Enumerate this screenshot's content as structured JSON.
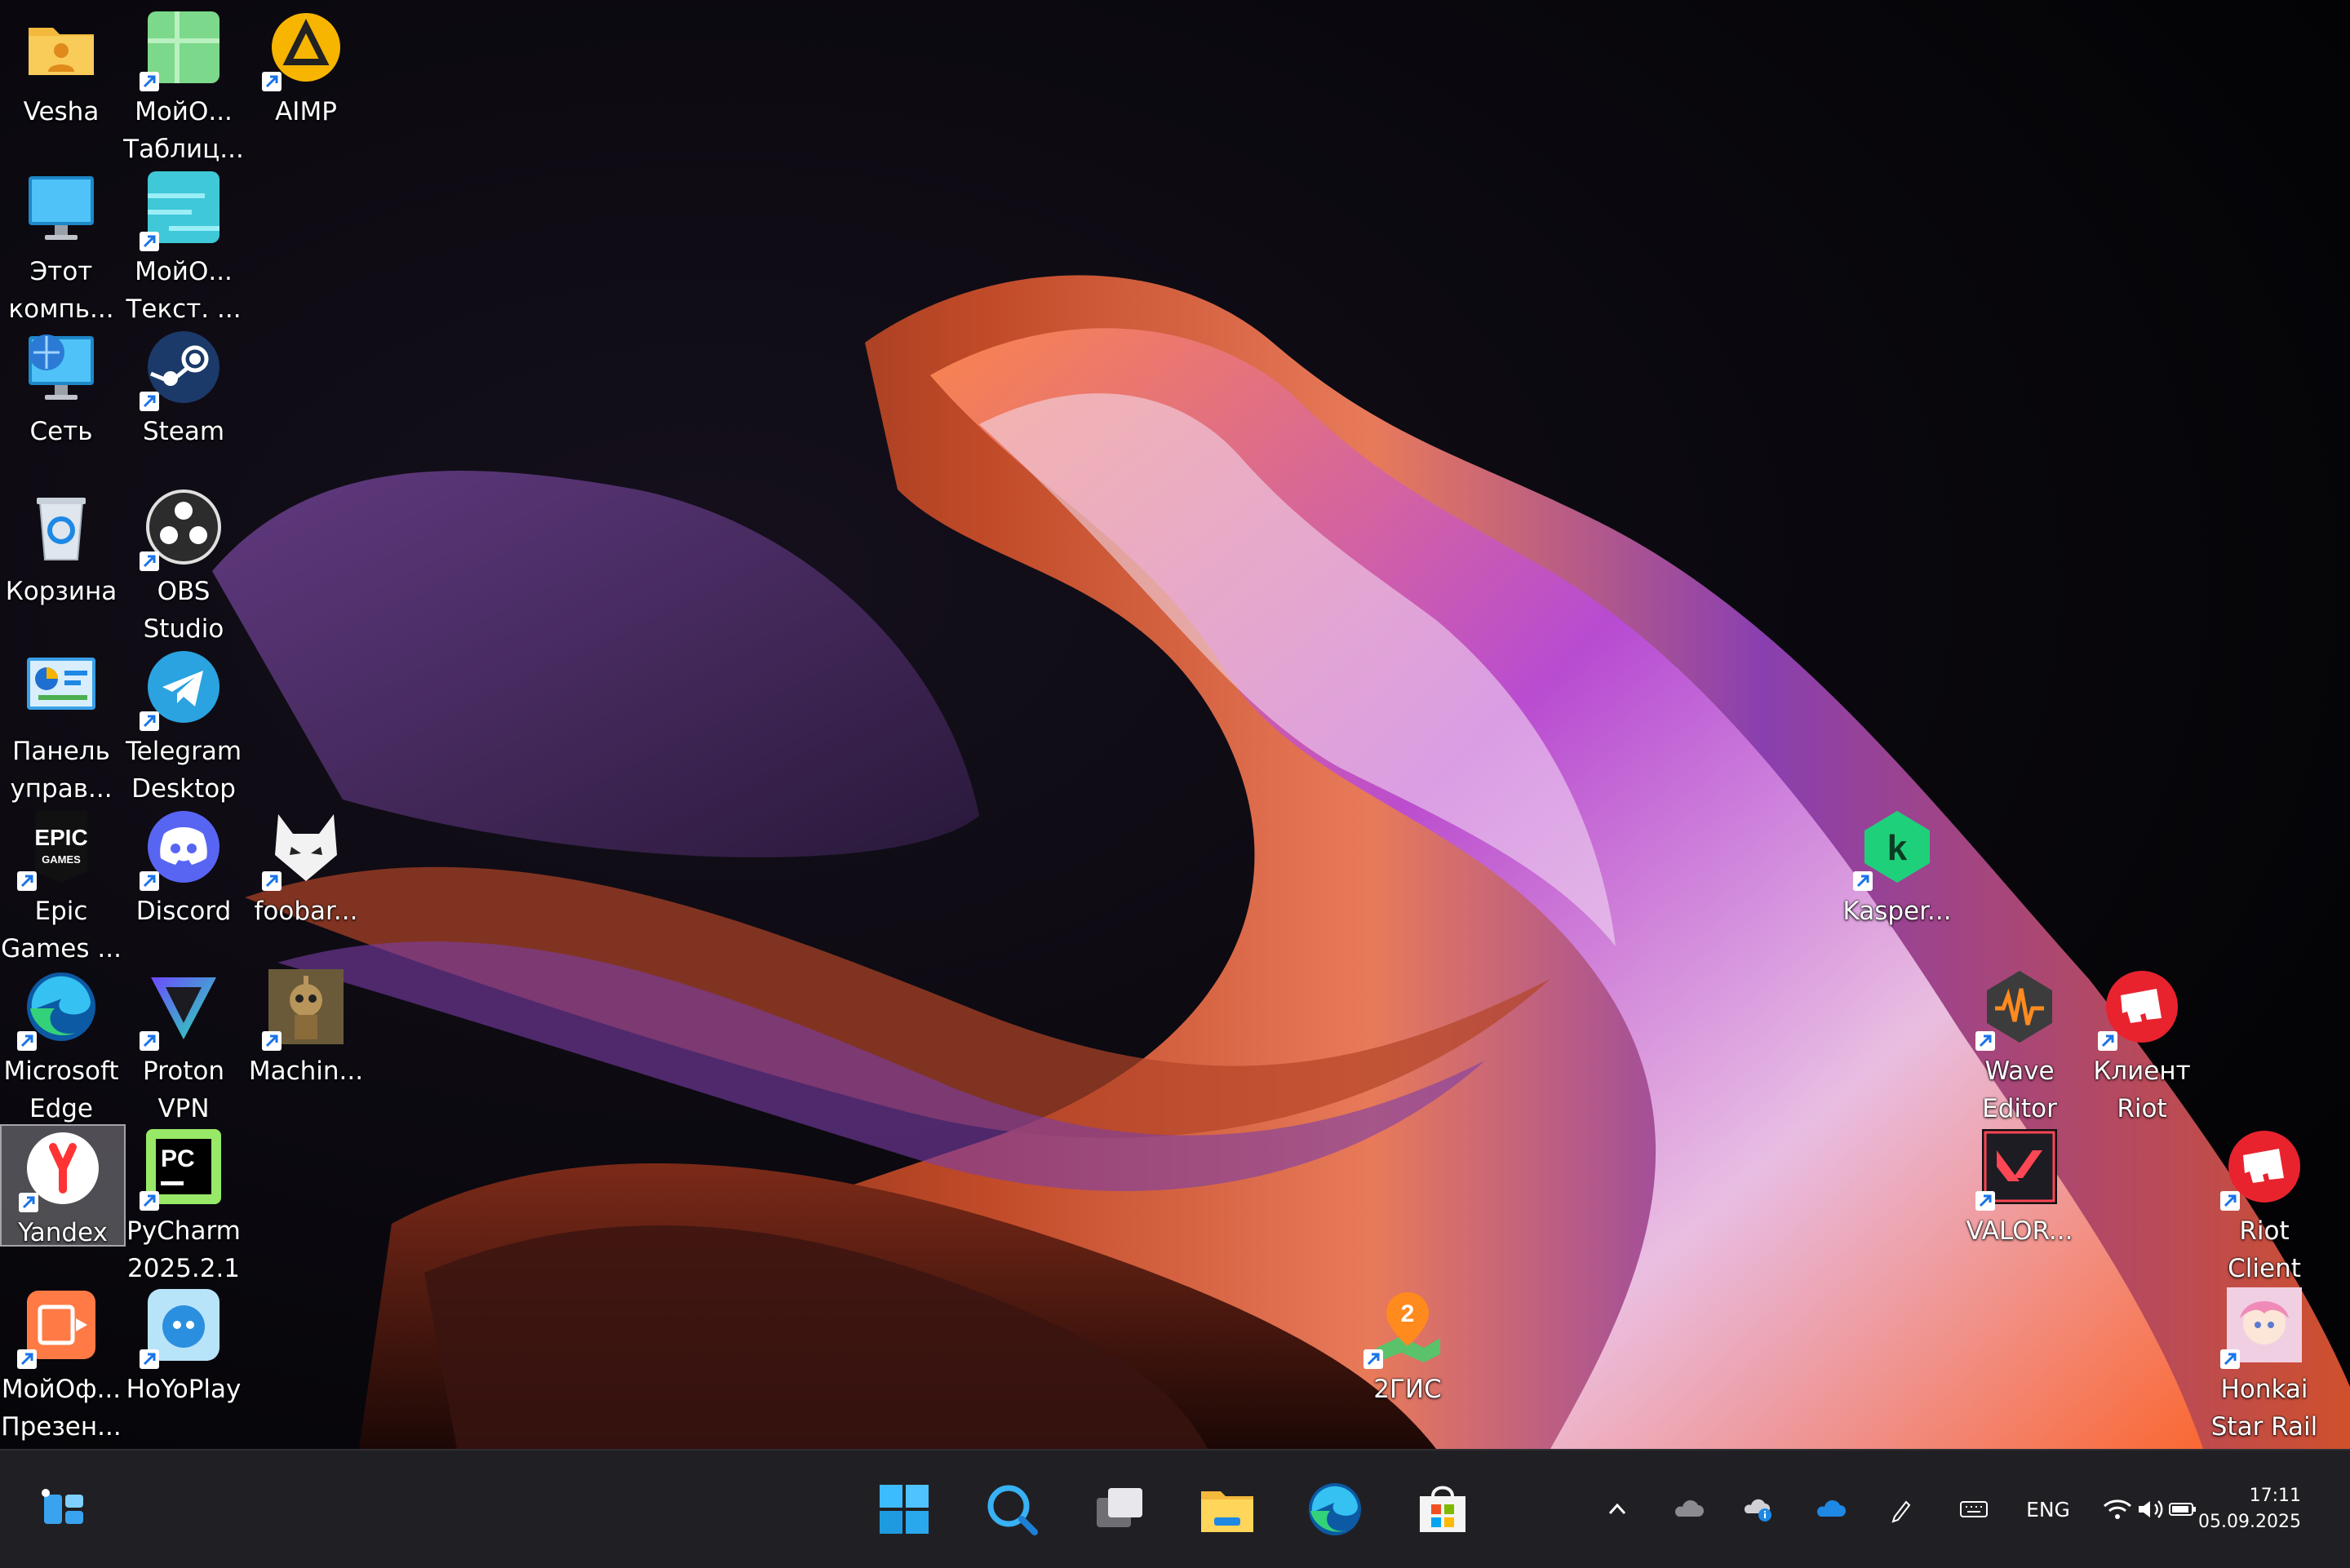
{
  "desktop": {
    "icons": [
      {
        "id": "vesha",
        "label": "Vesha",
        "icon": "user-folder-icon"
      },
      {
        "id": "myoffice-tables",
        "label": "МойО...\nТаблиц...",
        "icon": "spreadsheet-icon"
      },
      {
        "id": "aimp",
        "label": "AIMP",
        "icon": "aimp-icon"
      },
      {
        "id": "this-pc",
        "label": "Этот\nкомпь...",
        "icon": "computer-icon"
      },
      {
        "id": "myoffice-text",
        "label": "МойО...\nТекст. ...",
        "icon": "text-doc-icon"
      },
      {
        "id": "network",
        "label": "Сеть",
        "icon": "network-icon"
      },
      {
        "id": "steam",
        "label": "Steam",
        "icon": "steam-icon"
      },
      {
        "id": "recycle-bin",
        "label": "Корзина",
        "icon": "recycle-bin-icon"
      },
      {
        "id": "obs",
        "label": "OBS\nStudio",
        "icon": "obs-icon"
      },
      {
        "id": "control-panel",
        "label": "Панель\nуправ...",
        "icon": "control-panel-icon"
      },
      {
        "id": "telegram",
        "label": "Telegram\nDesktop",
        "icon": "telegram-icon"
      },
      {
        "id": "epic",
        "label": "Epic\nGames ...",
        "icon": "epic-games-icon"
      },
      {
        "id": "discord",
        "label": "Discord",
        "icon": "discord-icon"
      },
      {
        "id": "foobar",
        "label": "foobar...",
        "icon": "foobar-icon"
      },
      {
        "id": "edge",
        "label": "Microsoft\nEdge",
        "icon": "edge-icon"
      },
      {
        "id": "protonvpn",
        "label": "Proton\nVPN",
        "icon": "protonvpn-icon"
      },
      {
        "id": "machinarium",
        "label": "Machin...",
        "icon": "machinarium-icon"
      },
      {
        "id": "yandex",
        "label": "Yandex",
        "icon": "yandex-icon"
      },
      {
        "id": "pycharm",
        "label": "PyCharm\n2025.2.1",
        "icon": "pycharm-icon"
      },
      {
        "id": "myoffice-pres",
        "label": "МойОф...\nПрезен...",
        "icon": "presentation-icon"
      },
      {
        "id": "hoyoplay",
        "label": "HoYoPlay",
        "icon": "hoyoplay-icon"
      },
      {
        "id": "kaspersky",
        "label": "Kasper...",
        "icon": "kaspersky-icon"
      },
      {
        "id": "wave-editor",
        "label": "Wave\nEditor",
        "icon": "wave-editor-icon"
      },
      {
        "id": "riot-client-ru",
        "label": "Клиент\nRiot",
        "icon": "riot-client-icon"
      },
      {
        "id": "valorant",
        "label": "VALOR...",
        "icon": "valorant-icon"
      },
      {
        "id": "riot-client",
        "label": "Riot\nClient",
        "icon": "riot-client-icon"
      },
      {
        "id": "2gis",
        "label": "2ГИС",
        "icon": "2gis-icon"
      },
      {
        "id": "honkai",
        "label": "Honkai\nStar Rail",
        "icon": "honkai-icon"
      }
    ]
  },
  "taskbar": {
    "widgets_icon": "widgets-icon",
    "pinned": [
      "start-icon",
      "search-icon",
      "task-view-icon",
      "file-explorer-icon",
      "edge-icon",
      "store-icon"
    ],
    "tray": {
      "language": "ENG",
      "time": "17:11",
      "date": "05.09.2025"
    }
  }
}
